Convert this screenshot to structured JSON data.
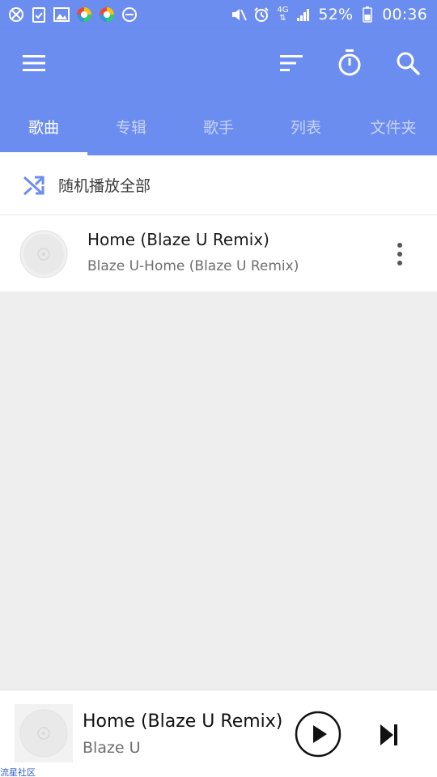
{
  "status_bar": {
    "left_icons": [
      "blocked-icon",
      "clipboard-check-icon",
      "image-icon",
      "color-app-icon",
      "color-app-icon",
      "do-not-disturb-icon"
    ],
    "right_icons": [
      "mute-icon",
      "alarm-icon",
      "network-4g-icon",
      "signal-icon",
      "battery-icon"
    ],
    "network_label": "4G",
    "battery_percent": "52%",
    "time": "00:36"
  },
  "toolbar": {
    "icons": [
      "menu-icon",
      "sort-icon",
      "timer-icon",
      "search-icon"
    ]
  },
  "tabs": [
    {
      "label": "歌曲",
      "active": true
    },
    {
      "label": "专辑",
      "active": false
    },
    {
      "label": "歌手",
      "active": false
    },
    {
      "label": "列表",
      "active": false
    },
    {
      "label": "文件夹",
      "active": false
    }
  ],
  "shuffle": {
    "label": "随机播放全部"
  },
  "songs": [
    {
      "title": "Home (Blaze U Remix)",
      "subtitle": "Blaze U-Home (Blaze U Remix)"
    }
  ],
  "mini_player": {
    "title": "Home (Blaze U Remix)",
    "artist": "Blaze U"
  },
  "watermark": "流星社区",
  "colors": {
    "accent": "#6c8df0",
    "shuffle_icon": "#6c8df0",
    "background": "#eeeeee"
  }
}
